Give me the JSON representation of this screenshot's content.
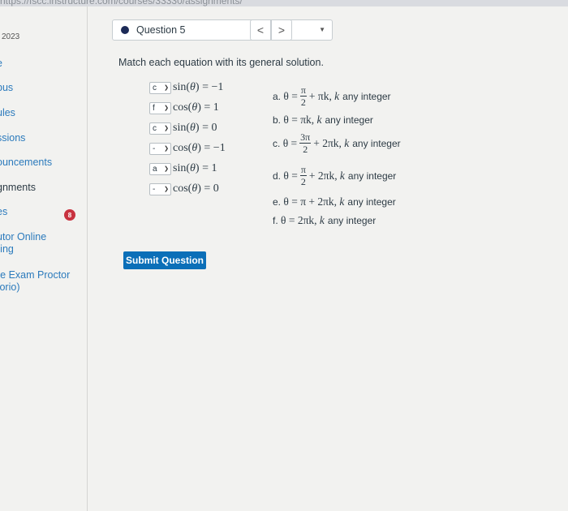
{
  "url_fragment": "https://fscc.instructure.com/courses/33330/assignments/",
  "sidebar": {
    "year": "2023",
    "items": [
      {
        "label": "e",
        "dark": false
      },
      {
        "label": "bus",
        "dark": false
      },
      {
        "label": "ules",
        "dark": false
      },
      {
        "label": "ssions",
        "dark": false
      },
      {
        "label": "ouncements",
        "dark": false
      },
      {
        "label": "gnments",
        "dark": true
      },
      {
        "label": "es",
        "dark": false
      },
      {
        "label": "utor Online",
        "dark": false
      },
      {
        "label": "ring",
        "dark": false
      },
      {
        "label": "re Exam Proctor",
        "dark": false
      },
      {
        "label": "torio)",
        "dark": false
      }
    ],
    "badge_count": "8"
  },
  "question_nav": {
    "current": "Question 5",
    "prev_symbol": "<",
    "next_symbol": ">"
  },
  "prompt": "Match each equation with its general solution.",
  "equations": [
    {
      "selected": "c",
      "func": "sin",
      "value": "−1"
    },
    {
      "selected": "f",
      "func": "cos",
      "value": "1"
    },
    {
      "selected": "c",
      "func": "sin",
      "value": "0"
    },
    {
      "selected": "-",
      "func": "cos",
      "value": "−1"
    },
    {
      "selected": "a",
      "func": "sin",
      "value": "1"
    },
    {
      "selected": "-",
      "func": "cos",
      "value": "0"
    }
  ],
  "solutions": [
    {
      "letter": "a.",
      "lhs": "θ =",
      "frac_num": "π",
      "frac_den": "2",
      "rest": "+ πk,",
      "var": "k",
      "text": "any integer"
    },
    {
      "letter": "b.",
      "lhs": "θ = πk,",
      "frac_num": "",
      "frac_den": "",
      "rest": "",
      "var": "k",
      "text": "any integer"
    },
    {
      "letter": "c.",
      "lhs": "θ =",
      "frac_num": "3π",
      "frac_den": "2",
      "rest": "+ 2πk,",
      "var": "k",
      "text": "any integer"
    },
    {
      "letter": "d.",
      "lhs": "θ =",
      "frac_num": "π",
      "frac_den": "2",
      "rest": "+ 2πk,",
      "var": "k",
      "text": "any integer"
    },
    {
      "letter": "e.",
      "lhs": "θ = π + 2πk,",
      "frac_num": "",
      "frac_den": "",
      "rest": "",
      "var": "k",
      "text": "any integer"
    },
    {
      "letter": "f.",
      "lhs": "θ = 2πk,",
      "frac_num": "",
      "frac_den": "",
      "rest": "",
      "var": "k",
      "text": "any integer"
    }
  ],
  "submit_label": "Submit Question",
  "colors": {
    "accent": "#0b6fb8",
    "badge": "#c8323f",
    "link": "#2b7abc"
  }
}
